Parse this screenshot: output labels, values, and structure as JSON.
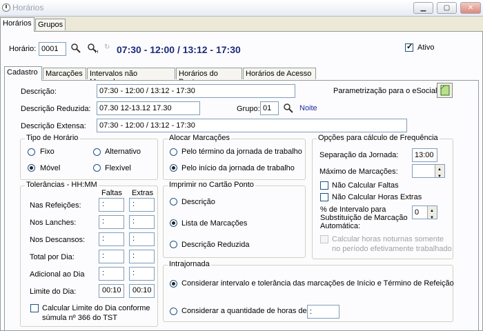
{
  "window": {
    "title": "Horários"
  },
  "top_tabs": [
    "Horários",
    "Grupos"
  ],
  "header": {
    "horario_label": "Horário:",
    "horario_value": "0001",
    "schedule_display": "07:30 - 12:00 / 13:12 - 17:30",
    "ativo_label": "Ativo",
    "ativo_checked": true
  },
  "inner_tabs": [
    "Cadastro",
    "Marcações",
    "Intervalos não Marcados",
    "Horários do Ponto",
    "Horários de Acesso"
  ],
  "form": {
    "descricao_label": "Descrição:",
    "descricao_value": "07:30 - 12:00 / 13:12 - 17:30",
    "descricao_reduzida_label": "Descrição Reduzida:",
    "descricao_reduzida_value": "07.30 12-13.12 17.30",
    "grupo_label": "Grupo:",
    "grupo_value": "01",
    "grupo_name": "Noite",
    "descricao_extensa_label": "Descrição Extensa:",
    "descricao_extensa_value": "07:30 - 12:00 / 13:12 - 17:30",
    "esocial_label": "Parametrização para o eSocial:"
  },
  "tipo_horario": {
    "title": "Tipo de Horário",
    "options": [
      "Fixo",
      "Alternativo",
      "Móvel",
      "Flexível"
    ],
    "selected": "Móvel"
  },
  "alocar": {
    "title": "Alocar Marcações",
    "options": [
      "Pelo término da jornada de trabalho",
      "Pelo início da jornada de trabalho"
    ],
    "selected": "Pelo início da jornada de trabalho"
  },
  "opcoes": {
    "title": "Opções para cálculo de Frequência",
    "separacao_label": "Separação da Jornada:",
    "separacao_value": "13:00",
    "maximo_label": "Máximo de Marcações:",
    "maximo_value": "",
    "nao_calc_faltas": "Não Calcular Faltas",
    "nao_calc_extras": "Não Calcular Horas Extras",
    "intervalo_label": "% de Intervalo para Substituição de Marcação Automática:",
    "intervalo_value": "0",
    "noturnas_label": "Calcular horas noturnas somente no período efetivamente trabalhado"
  },
  "tolerancias": {
    "title": "Tolerâncias - HH:MM",
    "col_faltas": "Faltas",
    "col_extras": "Extras",
    "rows": [
      {
        "label": "Nas Refeições:",
        "faltas": ":",
        "extras": ":"
      },
      {
        "label": "Nos Lanches:",
        "faltas": ":",
        "extras": ":"
      },
      {
        "label": "Nos Descansos:",
        "faltas": ":",
        "extras": ":"
      },
      {
        "label": "Total por Dia:",
        "faltas": ":",
        "extras": ":"
      },
      {
        "label": "Adicional ao Dia",
        "faltas": ":",
        "extras": ":"
      },
      {
        "label": "Limite do Dia:",
        "faltas": "00:10",
        "extras": "00:10"
      }
    ],
    "calc_limite_label": "Calcular Limite do Dia conforme súmula nº 366 do TST"
  },
  "imprimir": {
    "title": "Imprimir no Cartão Ponto",
    "options": [
      "Descrição",
      "Lista de Marcações",
      "Descrição Reduzida"
    ],
    "selected": "Lista de Marcações"
  },
  "intrajornada": {
    "title": "Intrajornada",
    "option1": "Considerar intervalo e tolerância das marcações de Início e Término de Refeição",
    "option2": "Considerar a quantidade de horas de",
    "option2_value": ":",
    "selected": 1
  }
}
